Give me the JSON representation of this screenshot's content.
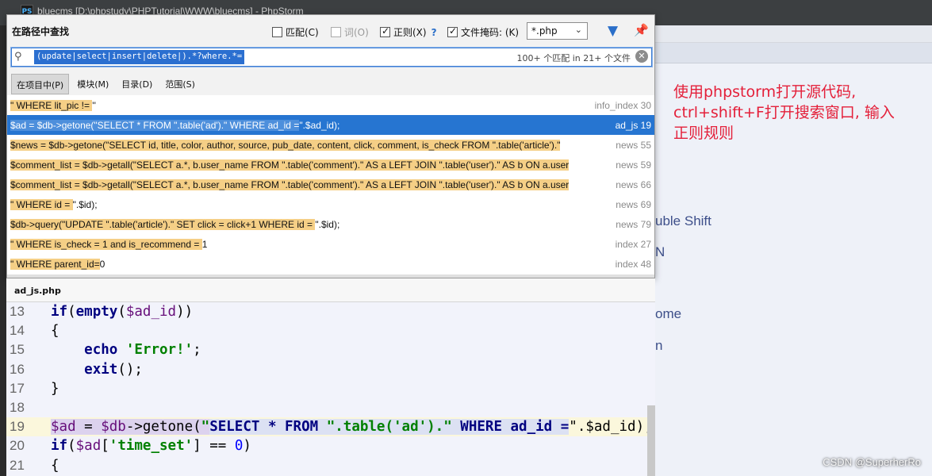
{
  "window": {
    "app_icon": "PS",
    "title": "bluecms [D:\\phpstudy\\PHPTutorial\\WWW\\bluecms] - PhpStorm"
  },
  "find_popup": {
    "title": "在路径中查找",
    "options": {
      "match_case": {
        "label": "匹配(C)",
        "checked": false
      },
      "words": {
        "label": "词(O)",
        "checked": false,
        "disabled": true
      },
      "regex": {
        "label": "正则(X)",
        "checked": true,
        "help": "?"
      },
      "file_mask": {
        "label": "文件掩码: (K)",
        "checked": true,
        "value": "*.php"
      }
    },
    "search": {
      "value": "(update|select|insert|delete|).*?where.*=",
      "result_count": "100+ 个匹配 in 21+ 个文件"
    },
    "scope_tabs": [
      {
        "label": "在项目中(P)",
        "active": true
      },
      {
        "label": "模块(M)",
        "active": false
      },
      {
        "label": "目录(D)",
        "active": false
      },
      {
        "label": "范围(S)",
        "active": false
      }
    ],
    "results": [
      {
        "parts": [
          {
            "t": "\" WHERE lit_pic != ",
            "h": true
          },
          {
            "t": "''",
            "h": false
          }
        ],
        "file": "info_index 30",
        "selected": false
      },
      {
        "parts": [
          {
            "t": "$ad = $db->getone(\"SELECT * FROM ",
            "h": true
          },
          {
            "t": "\".table('ad').\" WHERE ad_id =",
            "h": true
          },
          {
            "t": "\".$ad_id);",
            "h": false
          }
        ],
        "file": "ad_js 19",
        "selected": true
      },
      {
        "parts": [
          {
            "t": "$news = $db->getone(\"SELECT id, title, color, author, source, pub_date, content, click, comment, is_check FROM ",
            "h": true
          },
          {
            "t": "\".table('article').\"",
            "h": true
          }
        ],
        "file": "news 55",
        "selected": false
      },
      {
        "parts": [
          {
            "t": "$comment_list = $db->getall(\"SELECT a.*, b.user_name FROM ",
            "h": true
          },
          {
            "t": "\".table('comment').\" AS a LEFT JOIN ",
            "h": true
          },
          {
            "t": "\".table('user').\" AS b ON a.user",
            "h": true
          }
        ],
        "file": "news 59",
        "selected": false
      },
      {
        "parts": [
          {
            "t": "$comment_list = $db->getall(\"SELECT a.*, b.user_name FROM ",
            "h": true
          },
          {
            "t": "\".table('comment').\" AS a LEFT JOIN ",
            "h": true
          },
          {
            "t": "\".table('user').\" AS b ON a.user",
            "h": true
          }
        ],
        "file": "news 66",
        "selected": false
      },
      {
        "parts": [
          {
            "t": "\" WHERE id = ",
            "h": true
          },
          {
            "t": "\".$id);",
            "h": false
          }
        ],
        "file": "news 69",
        "selected": false
      },
      {
        "parts": [
          {
            "t": "$db->query(\"UPDATE ",
            "h": true
          },
          {
            "t": "\".table('article').\" SET click = click+1 WHERE id = ",
            "h": true
          },
          {
            "t": "\".$id);",
            "h": false
          }
        ],
        "file": "news 79",
        "selected": false
      },
      {
        "parts": [
          {
            "t": "\" WHERE is_check = 1 and is_recommend = ",
            "h": true
          },
          {
            "t": "1",
            "h": false
          }
        ],
        "file": "index 27",
        "selected": false
      },
      {
        "parts": [
          {
            "t": "\" WHERE parent_id=",
            "h": true
          },
          {
            "t": "0",
            "h": false
          }
        ],
        "file": "index 48",
        "selected": false
      }
    ]
  },
  "preview": {
    "filename": "ad_js.php",
    "lines": [
      {
        "n": "13",
        "tokens": [
          {
            "t": "if",
            "c": "kw"
          },
          {
            "t": "(",
            "c": ""
          },
          {
            "t": "empty",
            "c": "kw"
          },
          {
            "t": "(",
            "c": ""
          },
          {
            "t": "$ad_id",
            "c": "var"
          },
          {
            "t": "))",
            "c": ""
          }
        ]
      },
      {
        "n": "14",
        "tokens": [
          {
            "t": "{",
            "c": ""
          }
        ]
      },
      {
        "n": "15",
        "tokens": [
          {
            "t": "    ",
            "c": ""
          },
          {
            "t": "echo",
            "c": "kw"
          },
          {
            "t": " ",
            "c": ""
          },
          {
            "t": "'Error!'",
            "c": "str"
          },
          {
            "t": ";",
            "c": ""
          }
        ]
      },
      {
        "n": "16",
        "tokens": [
          {
            "t": "    ",
            "c": ""
          },
          {
            "t": "exit",
            "c": "kw"
          },
          {
            "t": "();",
            "c": ""
          }
        ]
      },
      {
        "n": "17",
        "tokens": [
          {
            "t": "}",
            "c": ""
          }
        ]
      },
      {
        "n": "18",
        "tokens": []
      },
      {
        "n": "19",
        "current": true,
        "tokens": [
          {
            "t": "$ad",
            "c": "var varhl"
          },
          {
            "t": " = ",
            "c": "varhl"
          },
          {
            "t": "$db",
            "c": "var varhl"
          },
          {
            "t": "->getone(",
            "c": "varhl"
          },
          {
            "t": "\"",
            "c": "str varhl"
          },
          {
            "t": "SELECT * FROM ",
            "c": "sqlkw inj"
          },
          {
            "t": "\".table('ad').\"",
            "c": "str inj"
          },
          {
            "t": " WHERE ad_id =",
            "c": "sqlkw inj"
          },
          {
            "t": "\".$ad_id);",
            "c": ""
          }
        ]
      },
      {
        "n": "20",
        "tokens": [
          {
            "t": "if",
            "c": "kw"
          },
          {
            "t": "(",
            "c": ""
          },
          {
            "t": "$ad",
            "c": "var"
          },
          {
            "t": "[",
            "c": ""
          },
          {
            "t": "'time_set'",
            "c": "str"
          },
          {
            "t": "] == ",
            "c": ""
          },
          {
            "t": "0",
            "c": "num"
          },
          {
            "t": ")",
            "c": ""
          }
        ]
      },
      {
        "n": "21",
        "tokens": [
          {
            "t": "{",
            "c": ""
          }
        ]
      }
    ]
  },
  "ide_background": {
    "fragments": [
      "uble Shift",
      "N",
      "ome",
      "n"
    ]
  },
  "annotation": {
    "lines": [
      "使用phpstorm打开源代码,",
      "ctrl+shift+F打开搜索窗口, 输入",
      "正则规则"
    ]
  },
  "watermark": "CSDN @SuperherRo",
  "colors": {
    "selection": "#2675d1",
    "match_highlight": "#f5cf86",
    "annotation_red": "#e4203a"
  }
}
